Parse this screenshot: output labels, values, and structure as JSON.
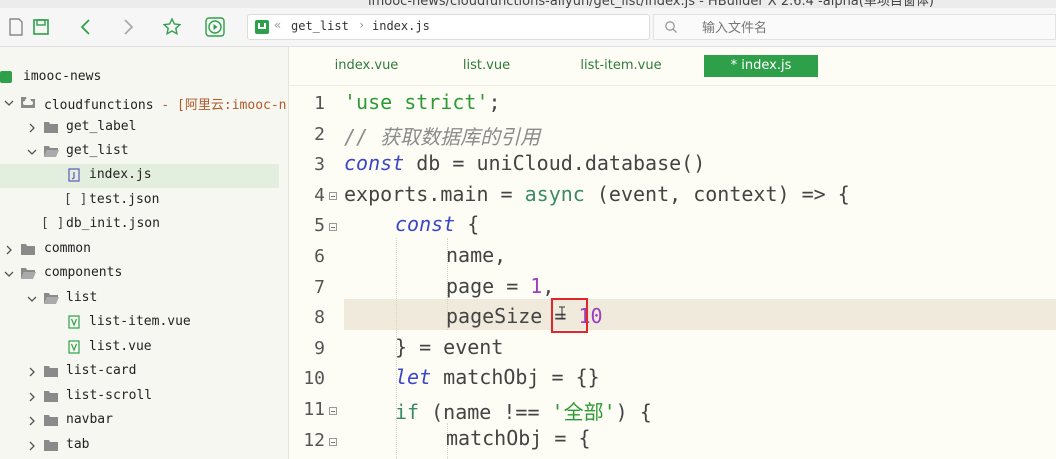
{
  "window": {
    "title": "imooc-news/cloudfunctions-aliyun/get_list/index.js - HBuilder X 2.6.4 -alpha(单项目窗体)"
  },
  "toolbar": {
    "icons": [
      "save-icon",
      "back-icon",
      "forward-icon",
      "star-icon",
      "run-icon"
    ]
  },
  "address": {
    "sep_left": "«",
    "crumbs": [
      "get_list",
      "index.js"
    ],
    "separator": "›"
  },
  "file_search": {
    "placeholder": "输入文件名"
  },
  "sidebar": {
    "items": [
      {
        "label": "imooc-news",
        "suffix": "",
        "icon": "project-icon"
      },
      {
        "label": "cloudfunctions",
        "suffix": " - [阿里云:imooc-n",
        "icon": "cloud-folder-icon"
      },
      {
        "label": "get_label",
        "suffix": "",
        "icon": "folder-icon"
      },
      {
        "label": "get_list",
        "suffix": "",
        "icon": "folder-open-icon"
      },
      {
        "label": "index.js",
        "suffix": "",
        "icon": "js-file-icon"
      },
      {
        "label": "test.json",
        "suffix": "",
        "icon": "json-file-icon"
      },
      {
        "label": "db_init.json",
        "suffix": "",
        "icon": "json-file-icon"
      },
      {
        "label": "common",
        "suffix": "",
        "icon": "folder-icon"
      },
      {
        "label": "components",
        "suffix": "",
        "icon": "folder-open-icon"
      },
      {
        "label": "list",
        "suffix": "",
        "icon": "folder-open-icon"
      },
      {
        "label": "list-item.vue",
        "suffix": "",
        "icon": "vue-file-icon"
      },
      {
        "label": "list.vue",
        "suffix": "",
        "icon": "vue-file-icon"
      },
      {
        "label": "list-card",
        "suffix": "",
        "icon": "folder-icon"
      },
      {
        "label": "list-scroll",
        "suffix": "",
        "icon": "folder-icon"
      },
      {
        "label": "navbar",
        "suffix": "",
        "icon": "folder-icon"
      },
      {
        "label": "tab",
        "suffix": "",
        "icon": "folder-icon"
      }
    ],
    "selected": "index.js"
  },
  "tabs": [
    {
      "label": "index.vue",
      "active": false
    },
    {
      "label": "list.vue",
      "active": false
    },
    {
      "label": "list-item.vue",
      "active": false
    },
    {
      "label": "* index.js",
      "active": true
    }
  ],
  "editor": {
    "line_numbers": [
      "1",
      "2",
      "3",
      "4",
      "5",
      "6",
      "7",
      "8",
      "9",
      "10",
      "11",
      "12"
    ],
    "highlighted_line": "8",
    "tokens": {
      "l1_str": "'use strict'",
      "l1_semi": ";",
      "l2_comment": "// 获取数据库的引用",
      "l3_const": "const",
      "l3_rest": " db = uniCloud.database()",
      "l4_rest": "exports.main = ",
      "l4_async": "async",
      "l4_tail": " (event, context) => {",
      "l5_const": "const",
      "l5_brace": " {",
      "l6": "name,",
      "l7_a": "page = ",
      "l7_num": "1",
      "l7_b": ",",
      "l8_a": "pageSize ",
      "l8_eq": "= ",
      "l8_num": "10",
      "l9": "} = event",
      "l10_let": "let",
      "l10_rest": " matchObj = {}",
      "l11_if": "if",
      "l11_a": " (name !== ",
      "l11_str": "'全部'",
      "l11_b": ") {",
      "l12": "matchObj = {"
    }
  },
  "colors": {
    "accent": "#2fa04a",
    "keyword": "#3a46c6",
    "string": "#2d9a34",
    "number": "#9b3fc0",
    "annotation": "#e3262b"
  }
}
